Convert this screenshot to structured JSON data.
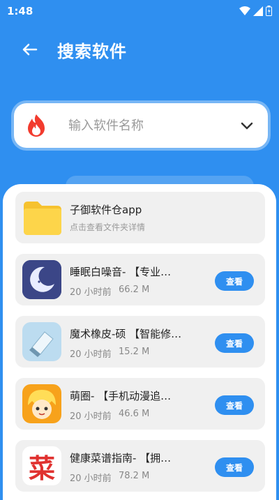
{
  "status_bar": {
    "time": "1:48"
  },
  "header": {
    "title": "搜索软件"
  },
  "search": {
    "placeholder": "输入软件名称"
  },
  "folder_card": {
    "title": "子御软件仓app",
    "subtitle": "点击查看文件夹详情"
  },
  "apps": [
    {
      "name": "睡眠白噪音-      【专业…",
      "time": "20 小时前",
      "size": "66.2 M",
      "button": "查看",
      "icon": "moon-sleep-icon"
    },
    {
      "name": "魔术橡皮-硕    【智能修…",
      "time": "20 小时前",
      "size": "15.2 M",
      "button": "查看",
      "icon": "eraser-icon"
    },
    {
      "name": "萌圈-       【手机动漫追…",
      "time": "20 小时前",
      "size": "46.6 M",
      "button": "查看",
      "icon": "anime-character-icon"
    },
    {
      "name": "健康菜谱指南-      【拥…",
      "time": "20 小时前",
      "size": "78.2 M",
      "button": "查看",
      "icon": "cai-character-icon",
      "icon_text": "菜"
    }
  ],
  "colors": {
    "primary": "#2f8ff0",
    "card_bg": "#f0f0f0",
    "folder": "#fdd54a",
    "flame": "#f23b2e"
  }
}
